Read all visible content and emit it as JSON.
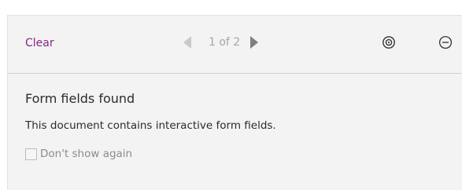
{
  "toolbar": {
    "clear_label": "Clear",
    "page_indicator": "1 of 2",
    "prev_icon": "triangle-left-icon",
    "next_icon": "triangle-right-icon",
    "settings_icon": "target-settings-icon",
    "collapse_icon": "minus-circle-icon"
  },
  "notice": {
    "heading": "Form fields found",
    "message": "This document contains interactive form fields.",
    "checkbox_label": "Don't show again",
    "checkbox_checked": false
  },
  "colors": {
    "accent": "#80287f",
    "panel_bg": "#f3f3f3"
  }
}
